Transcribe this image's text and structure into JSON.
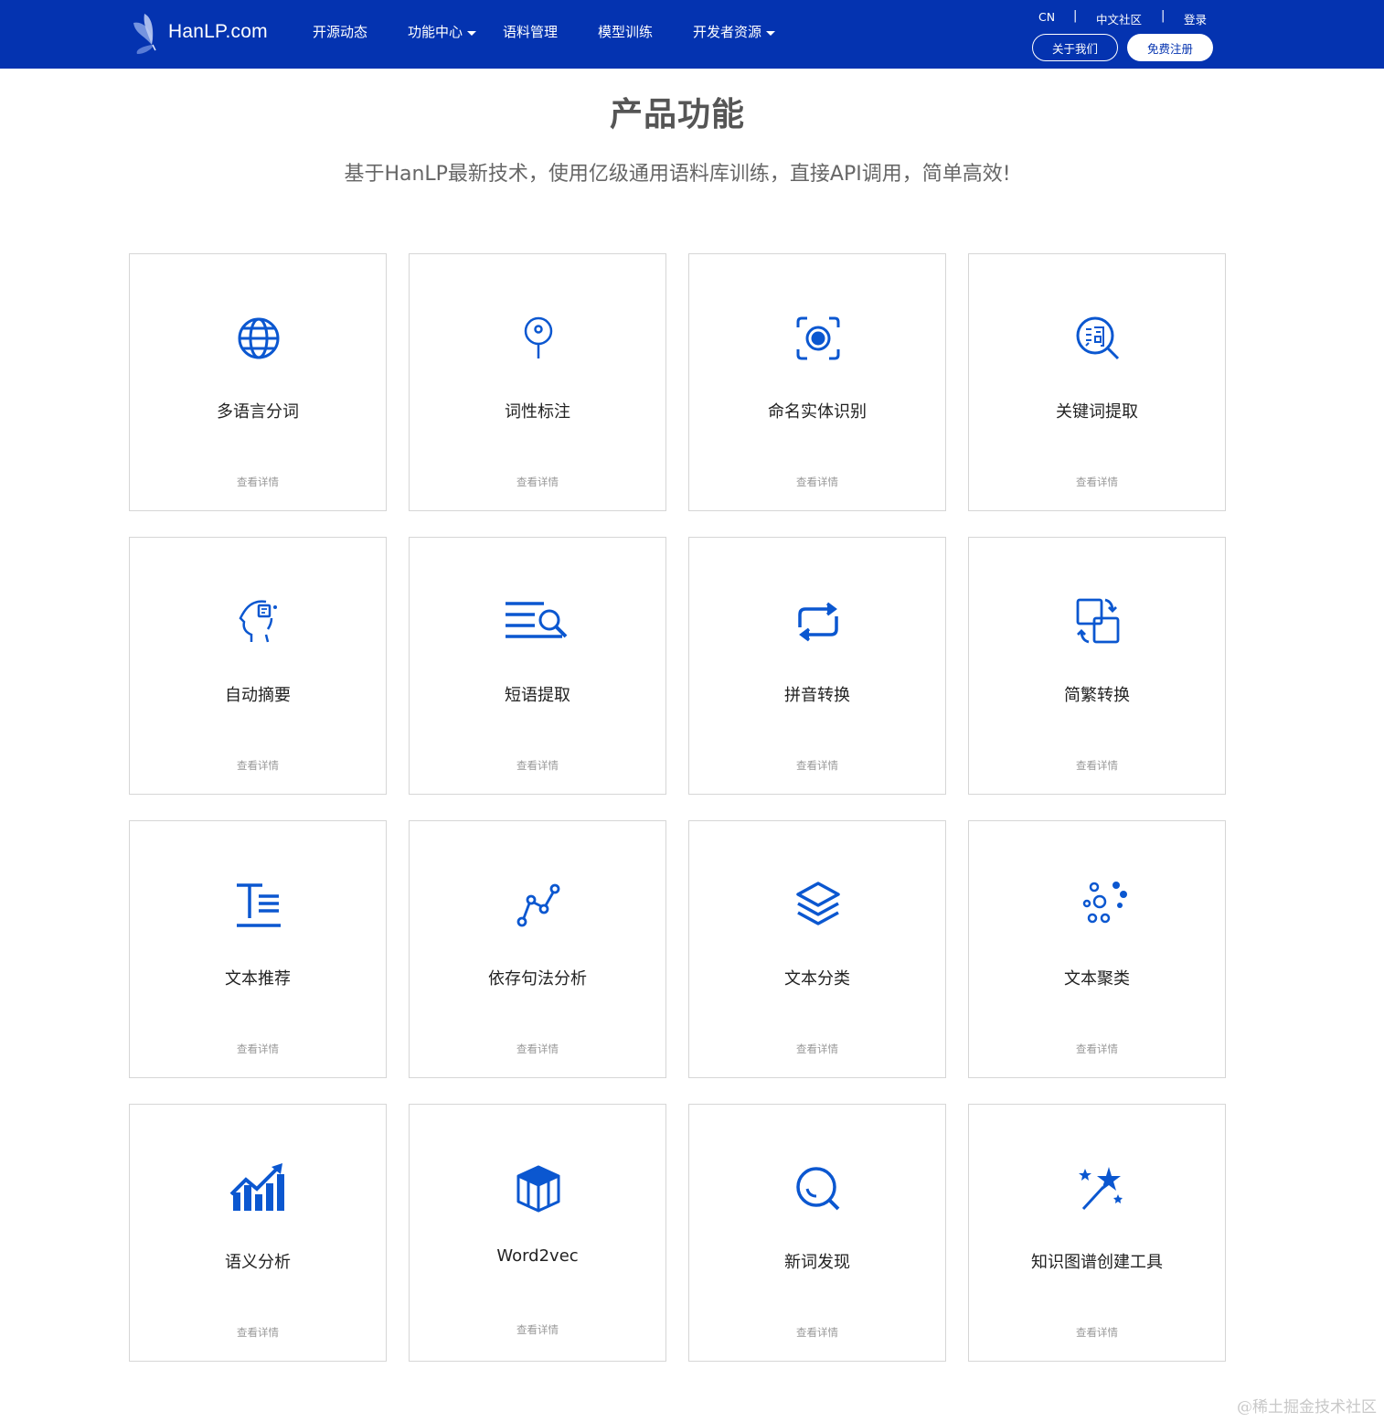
{
  "header": {
    "logo_text": "HanLP.com",
    "nav": [
      {
        "label": "开源动态",
        "has_dropdown": false
      },
      {
        "label": "功能中心",
        "has_dropdown": true
      },
      {
        "label": "语料管理",
        "has_dropdown": false
      },
      {
        "label": "模型训练",
        "has_dropdown": false
      },
      {
        "label": "开发者资源",
        "has_dropdown": true
      }
    ],
    "util_links": [
      "CN",
      "中文社区",
      "登录"
    ],
    "separator": "|",
    "about_button": "关于我们",
    "register_button": "免费注册"
  },
  "section": {
    "title": "产品功能",
    "subtitle": "基于HanLP最新技术，使用亿级通用语料库训练，直接API调用，简单高效!"
  },
  "cards": [
    {
      "title": "多语言分词",
      "link": "查看详情",
      "icon": "globe-icon"
    },
    {
      "title": "词性标注",
      "link": "查看详情",
      "icon": "pin-icon"
    },
    {
      "title": "命名实体识别",
      "link": "查看详情",
      "icon": "focus-target-icon"
    },
    {
      "title": "关键词提取",
      "link": "查看详情",
      "icon": "word-search-icon"
    },
    {
      "title": "自动摘要",
      "link": "查看详情",
      "icon": "head-thinking-icon"
    },
    {
      "title": "短语提取",
      "link": "查看详情",
      "icon": "text-search-icon"
    },
    {
      "title": "拼音转换",
      "link": "查看详情",
      "icon": "loop-arrows-icon"
    },
    {
      "title": "简繁转换",
      "link": "查看详情",
      "icon": "convert-squares-icon"
    },
    {
      "title": "文本推荐",
      "link": "查看详情",
      "icon": "text-format-icon"
    },
    {
      "title": "依存句法分析",
      "link": "查看详情",
      "icon": "node-graph-icon"
    },
    {
      "title": "文本分类",
      "link": "查看详情",
      "icon": "layers-icon"
    },
    {
      "title": "文本聚类",
      "link": "查看详情",
      "icon": "bubbles-cluster-icon"
    },
    {
      "title": "语义分析",
      "link": "查看详情",
      "icon": "trend-chart-icon"
    },
    {
      "title": "Word2vec",
      "link": "查看详情",
      "icon": "cube-icon"
    },
    {
      "title": "新词发现",
      "link": "查看详情",
      "icon": "magnifier-icon"
    },
    {
      "title": "知识图谱创建工具",
      "link": "查看详情",
      "icon": "magic-wand-icon"
    }
  ],
  "watermark": "@稀土掘金技术社区",
  "colors": {
    "brand": "#0433b0",
    "icon": "#0b57d0",
    "border": "#d6d6d6"
  }
}
